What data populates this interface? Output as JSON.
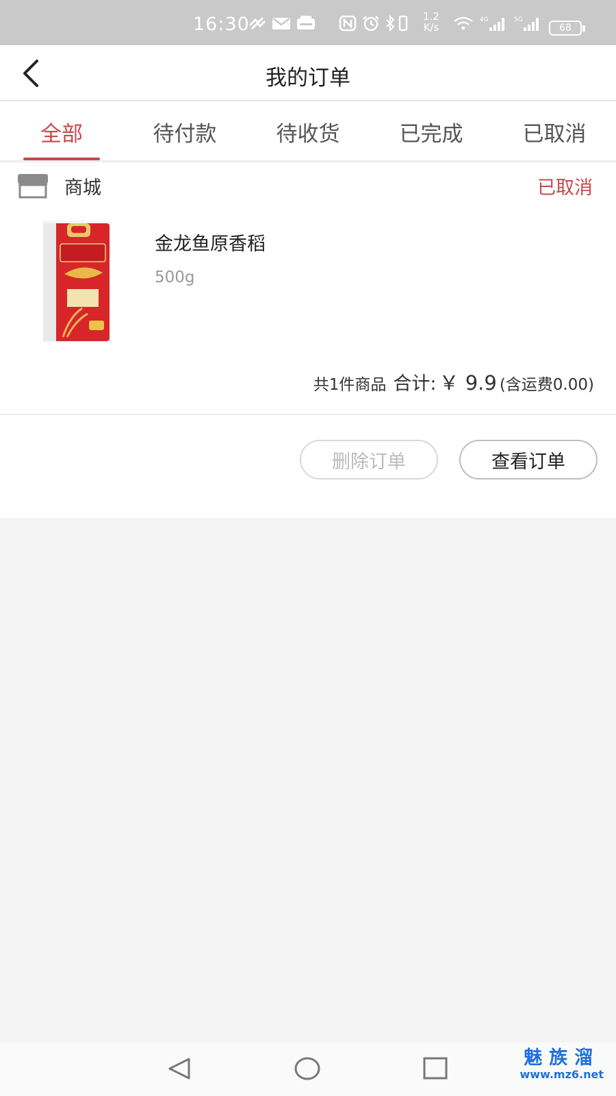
{
  "status_bar": {
    "time": "16:30",
    "network_speed_value": "1.2",
    "network_speed_unit": "K/s",
    "battery": "68",
    "icons": [
      "link-icon",
      "mail-icon",
      "message-icon",
      "nfc-icon",
      "alarm-icon",
      "bluetooth-icon",
      "vibrate-icon",
      "wifi-icon",
      "signal-4g-icon",
      "signal-5g-icon",
      "battery-icon"
    ]
  },
  "header": {
    "title": "我的订单",
    "back_icon": "chevron-left-icon"
  },
  "tabs": [
    {
      "label": "全部",
      "active": true
    },
    {
      "label": "待付款",
      "active": false
    },
    {
      "label": "待收货",
      "active": false
    },
    {
      "label": "已完成",
      "active": false
    },
    {
      "label": "已取消",
      "active": false
    }
  ],
  "order": {
    "store_name": "商城",
    "store_icon": "store-icon",
    "status": "已取消",
    "product": {
      "name": "金龙鱼原香稻",
      "spec": "500g",
      "image_icon": "rice-bag-image"
    },
    "summary": {
      "count_text": "共1件商品",
      "total_label": "合计:",
      "total_value": "￥ 9.9",
      "shipping_text": "(含运费0.00)"
    },
    "buttons": {
      "delete_label": "删除订单",
      "view_label": "查看订单"
    }
  },
  "navbar": {
    "back_icon": "triangle-back-icon",
    "home_icon": "circle-home-icon",
    "recents_icon": "square-recents-icon"
  },
  "watermark": {
    "line1": "魅族溜",
    "line2": "www.mz6.net"
  },
  "colors": {
    "accent": "#c9474a",
    "status_bar": "#c9c9c9",
    "page_bg": "#f4f4f4",
    "watermark": "#1e6fe0"
  }
}
